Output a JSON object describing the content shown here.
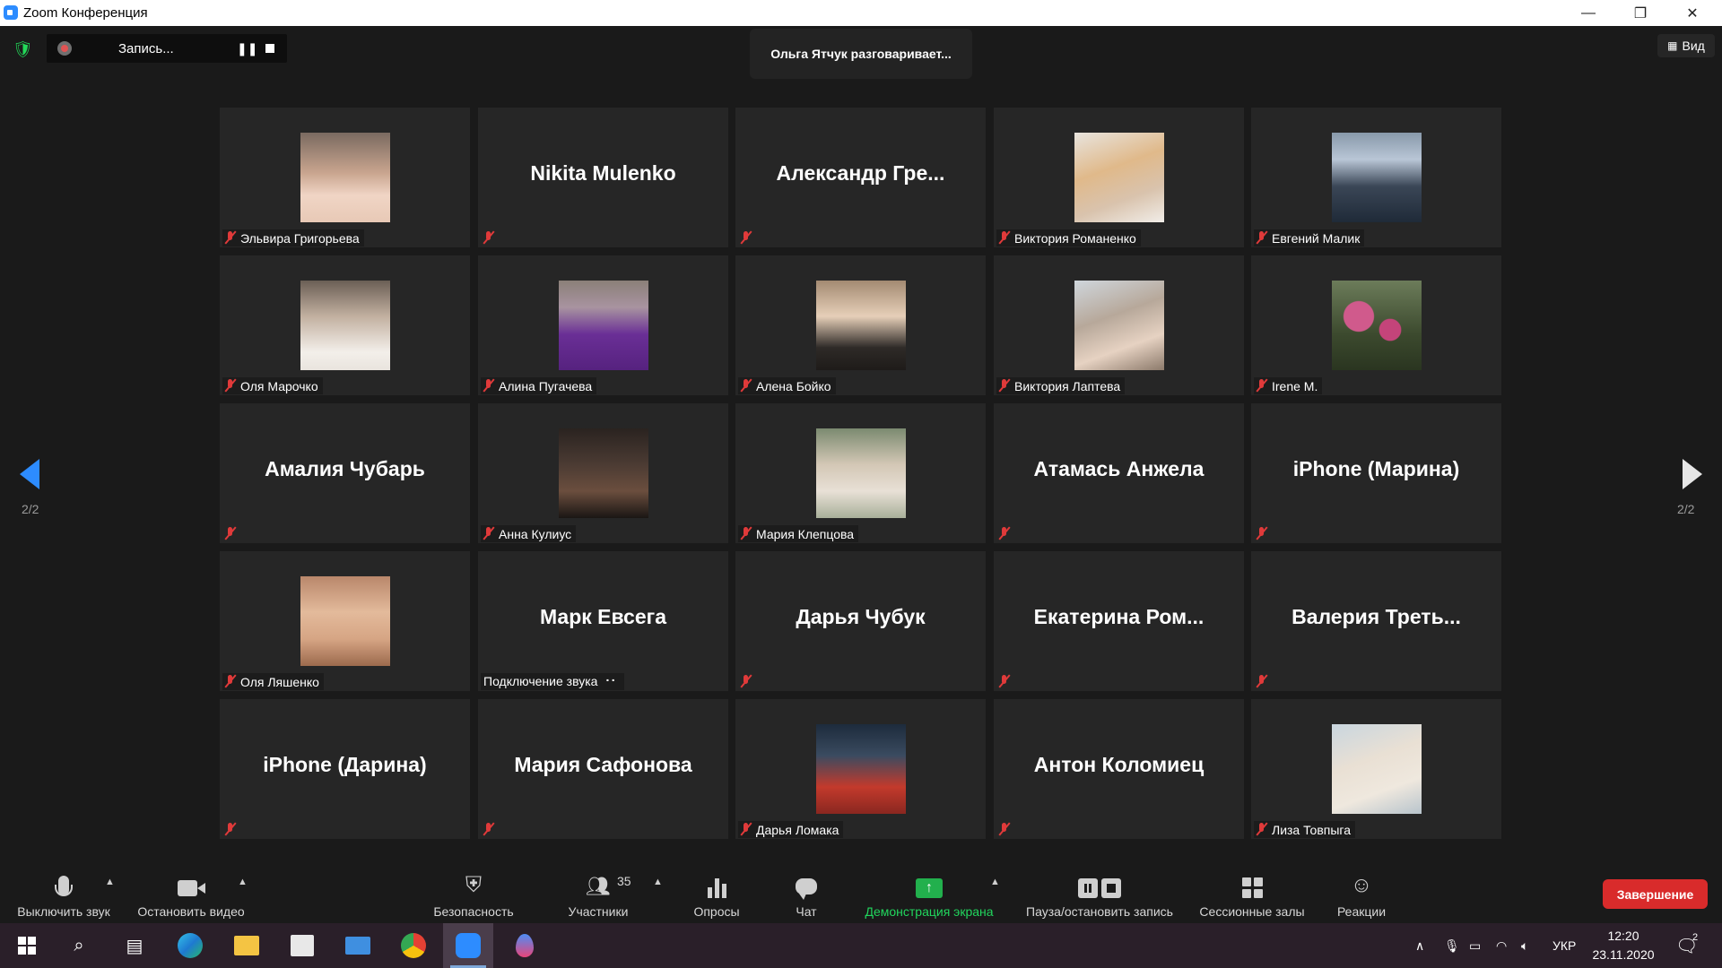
{
  "window": {
    "title": "Zoom Конференция",
    "controls": {
      "minimize": "—",
      "restore": "❐",
      "close": "✕"
    }
  },
  "topbar": {
    "recording_label": "Запись...",
    "talking": "Ольга Ятчук разговаривает...",
    "view_label": "Вид"
  },
  "pagination": {
    "left": "2/2",
    "right": "2/2"
  },
  "tiles": [
    {
      "name": "Эльвира Григорьева",
      "video": true,
      "avatar": 0,
      "muted": true
    },
    {
      "name": "Nikita Mulenko",
      "video": false,
      "muted": true
    },
    {
      "name": "Александр Гре...",
      "video": false,
      "muted": true
    },
    {
      "name": "Виктория Романенко",
      "video": true,
      "avatar": 1,
      "muted": true
    },
    {
      "name": "Евгений Малик",
      "video": true,
      "avatar": 2,
      "muted": true
    },
    {
      "name": "Оля Марочко",
      "video": true,
      "avatar": 3,
      "muted": true
    },
    {
      "name": "Алина Пугачева",
      "video": true,
      "avatar": 4,
      "muted": true
    },
    {
      "name": "Алена Бойко",
      "video": true,
      "avatar": 5,
      "muted": true
    },
    {
      "name": "Виктория Лаптева",
      "video": true,
      "avatar": 6,
      "muted": true
    },
    {
      "name": "Irene M.",
      "video": true,
      "avatar": 7,
      "muted": true
    },
    {
      "name": "Амалия Чубарь",
      "video": false,
      "muted": true
    },
    {
      "name": "Анна Кулиус",
      "video": true,
      "avatar": 8,
      "muted": true
    },
    {
      "name": "Мария Клепцова",
      "video": true,
      "avatar": 9,
      "muted": true
    },
    {
      "name": "Атамась Анжела",
      "video": false,
      "muted": true
    },
    {
      "name": "iPhone (Марина)",
      "video": false,
      "muted": true
    },
    {
      "name": "Оля Ляшенко",
      "video": true,
      "avatar": 10,
      "muted": true
    },
    {
      "name": "Марк Евсега",
      "video": false,
      "muted": false,
      "status": "Подключение звука ⠐⠂"
    },
    {
      "name": "Дарья Чубук",
      "video": false,
      "muted": true
    },
    {
      "name": "Екатерина Ром...",
      "video": false,
      "muted": true
    },
    {
      "name": "Валерия Треть...",
      "video": false,
      "muted": true
    },
    {
      "name": "iPhone (Дарина)",
      "video": false,
      "muted": true
    },
    {
      "name": "Мария Сафонова",
      "video": false,
      "muted": true
    },
    {
      "name": "Дарья Ломака",
      "video": true,
      "avatar": 11,
      "muted": true
    },
    {
      "name": "Антон Коломиец",
      "video": false,
      "muted": true
    },
    {
      "name": "Лиза Товпыга",
      "video": true,
      "avatar": 12,
      "muted": true
    }
  ],
  "toolbar": {
    "mute": "Выключить звук",
    "video": "Остановить видео",
    "security": "Безопасность",
    "participants": "Участники",
    "participants_count": "35",
    "polls": "Опросы",
    "chat": "Чат",
    "share": "Демонстрация экрана",
    "record": "Пауза/остановить запись",
    "rooms": "Сессионные залы",
    "reactions": "Реакции",
    "end": "Завершение"
  },
  "taskbar": {
    "lang": "УКР",
    "time": "12:20",
    "date": "23.11.2020",
    "notifications": "2"
  }
}
